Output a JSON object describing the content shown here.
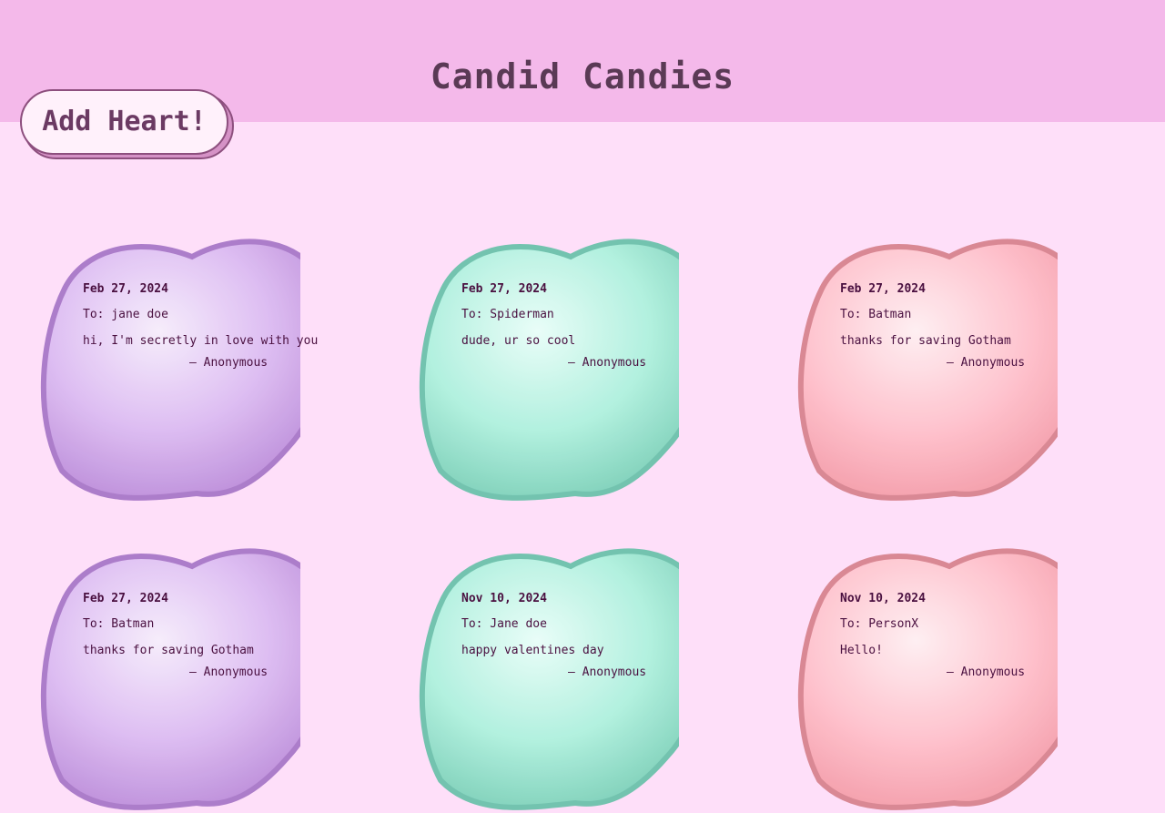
{
  "app": {
    "title": "Candid Candies",
    "add_button_label": "Add Heart!"
  },
  "colors": {
    "header_bg": "#f4b9ea",
    "page_bg": "#fedff9",
    "purple_heart": "#d9b3f0",
    "mint_heart": "#a8f0dc",
    "pink_heart": "#ffbcc8"
  },
  "hearts": [
    {
      "date": "Feb 27, 2024",
      "to": "To: jane doe",
      "message": "hi, I'm secretly in love with you",
      "signature": "– Anonymous",
      "color": "purple"
    },
    {
      "date": "Feb 27, 2024",
      "to": "To: Spiderman",
      "message": "dude, ur so cool",
      "signature": "– Anonymous",
      "color": "mint"
    },
    {
      "date": "Feb 27, 2024",
      "to": "To: Batman",
      "message": "thanks for saving Gotham",
      "signature": "– Anonymous",
      "color": "pink"
    },
    {
      "date": "Feb 27, 2024",
      "to": "To: Batman",
      "message": "thanks for saving Gotham",
      "signature": "– Anonymous",
      "color": "purple"
    },
    {
      "date": "Nov 10, 2024",
      "to": "To: Jane doe",
      "message": "happy valentines day",
      "signature": "– Anonymous",
      "color": "mint"
    },
    {
      "date": "Nov 10, 2024",
      "to": "To: PersonX",
      "message": "Hello!",
      "signature": "– Anonymous",
      "color": "pink"
    }
  ]
}
